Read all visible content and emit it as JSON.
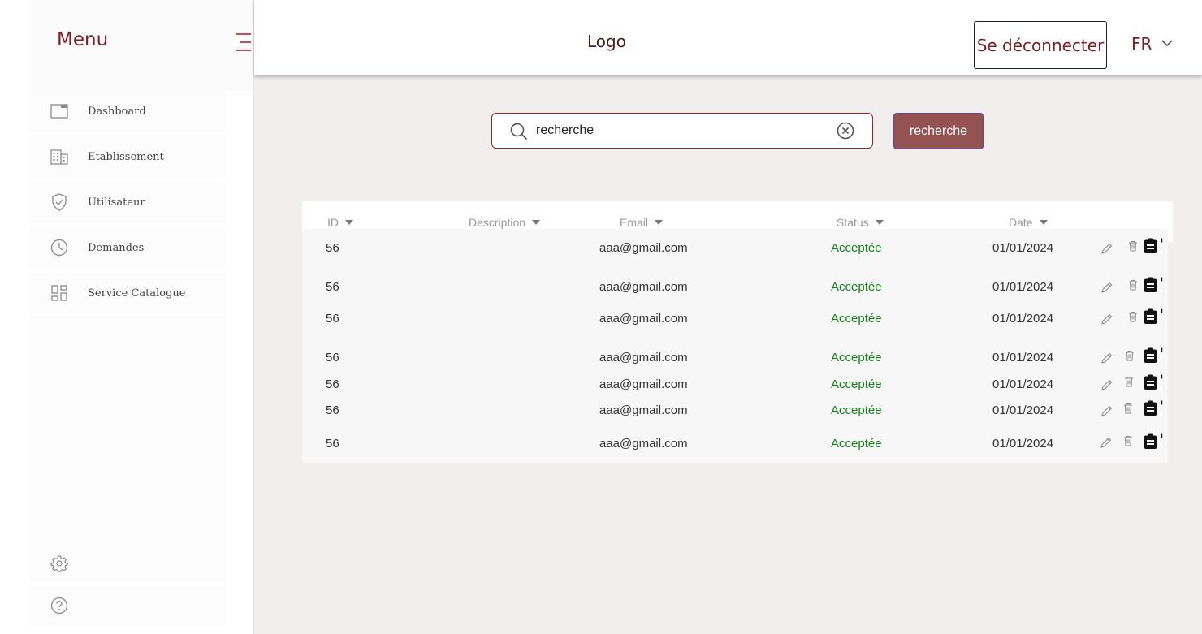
{
  "sidebar": {
    "title": "Menu",
    "items": [
      {
        "label": "Dashboard",
        "icon": "window-icon"
      },
      {
        "label": "Etablissement",
        "icon": "building-icon"
      },
      {
        "label": "Utilisateur",
        "icon": "shield-icon"
      },
      {
        "label": "Demandes",
        "icon": "clock-icon"
      },
      {
        "label": "Service Catalogue",
        "icon": "grid-icon"
      }
    ],
    "bottom_icons": [
      "gear-icon",
      "help-icon"
    ]
  },
  "header": {
    "logo": "Logo",
    "logout_label": "Se déconnecter",
    "language": "FR"
  },
  "search": {
    "value": "recherche",
    "button_label": "recherche"
  },
  "table": {
    "columns": [
      "ID",
      "Description",
      "Email",
      "Status",
      "Date"
    ],
    "rows": [
      {
        "id": "56",
        "description": "",
        "email": "aaa@gmail.com",
        "status": "Acceptée",
        "date": "01/01/2024"
      },
      {
        "id": "56",
        "description": "",
        "email": "aaa@gmail.com",
        "status": "Acceptée",
        "date": "01/01/2024"
      },
      {
        "id": "56",
        "description": "",
        "email": "aaa@gmail.com",
        "status": "Acceptée",
        "date": "01/01/2024"
      },
      {
        "id": "56",
        "description": "",
        "email": "aaa@gmail.com",
        "status": "Acceptée",
        "date": "01/01/2024"
      },
      {
        "id": "56",
        "description": "",
        "email": "aaa@gmail.com",
        "status": "Acceptée",
        "date": "01/01/2024"
      },
      {
        "id": "56",
        "description": "",
        "email": "aaa@gmail.com",
        "status": "Acceptée",
        "date": "01/01/2024"
      },
      {
        "id": "56",
        "description": "",
        "email": "aaa@gmail.com",
        "status": "Acceptée",
        "date": "01/01/2024"
      }
    ],
    "row_actions": [
      "edit-icon",
      "delete-icon",
      "clipboard-icon"
    ]
  },
  "colors": {
    "brand": "#7a1f24",
    "accent": "#955252",
    "status_accepted": "#17821d",
    "background": "#f3eeee"
  }
}
